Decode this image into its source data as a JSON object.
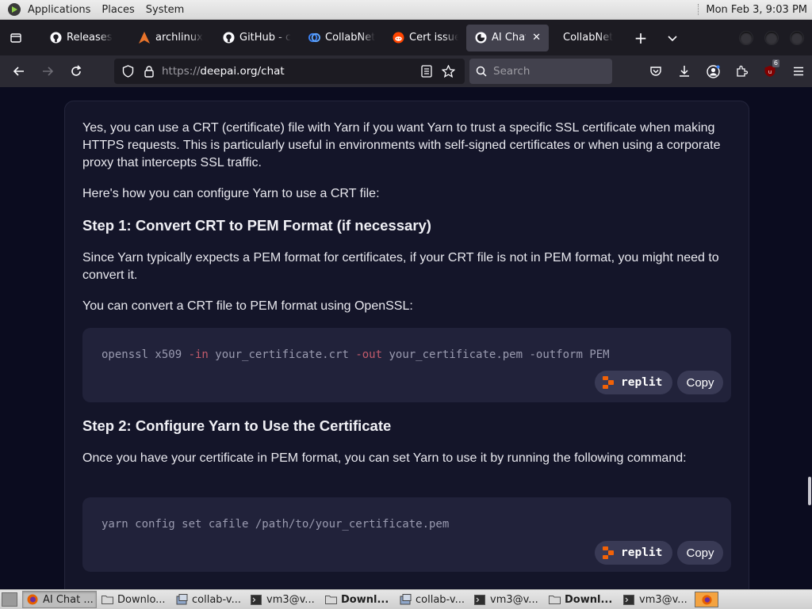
{
  "panel": {
    "menus": [
      "Applications",
      "Places",
      "System"
    ],
    "clock": "Mon Feb  3,  9:03 PM"
  },
  "tabs": [
    {
      "label": "Releases",
      "icon": "github-icon"
    },
    {
      "label": "archlinux",
      "icon": "archlinux-icon"
    },
    {
      "label": "GitHub - c",
      "icon": "github-icon"
    },
    {
      "label": "CollabNet",
      "icon": "collabnet-icon"
    },
    {
      "label": "Cert issue",
      "icon": "reddit-icon"
    },
    {
      "label": "AI Chat",
      "icon": "deepai-icon",
      "active": true
    },
    {
      "label": "CollabNet",
      "icon": "none"
    }
  ],
  "nav": {
    "url_prefix": "https://",
    "url_host": "deepai.org/chat",
    "search_placeholder": "Search",
    "extension_badge": "6"
  },
  "content": {
    "p1": "Yes, you can use a CRT (certificate) file with Yarn if you want Yarn to trust a specific SSL certificate when making HTTPS requests. This is particularly useful in environments with self-signed certificates or when using a corporate proxy that intercepts SSL traffic.",
    "p2": "Here's how you can configure Yarn to use a CRT file:",
    "h1": "Step 1: Convert CRT to PEM Format (if necessary)",
    "p3": "Since Yarn typically expects a PEM format for certificates, if your CRT file is not in PEM format, you might need to convert it.",
    "p4": "You can convert a CRT file to PEM format using OpenSSL:",
    "code1": {
      "a": "openssl x509 ",
      "b": "-in",
      "c": " your_certificate.crt ",
      "d": "-out",
      "e": " your_certificate.pem -outform PEM"
    },
    "h2": "Step 2: Configure Yarn to Use the Certificate",
    "p5": "Once you have your certificate in PEM format, you can set Yarn to use it by running the following command:",
    "code2": "yarn config set cafile /path/to/your_certificate.pem",
    "replit_label": "replit",
    "copy_label": "Copy"
  },
  "taskbar": [
    {
      "label": "AI Chat ...",
      "icon": "firefox-icon",
      "active": true,
      "bold": false
    },
    {
      "label": "Downlo...",
      "icon": "folder-icon",
      "bold": false
    },
    {
      "label": "collab-v...",
      "icon": "app-icon",
      "bold": false
    },
    {
      "label": "vm3@v...",
      "icon": "terminal-icon",
      "bold": false
    },
    {
      "label": "Downl...",
      "icon": "folder-icon",
      "bold": true
    },
    {
      "label": "collab-v...",
      "icon": "app-icon",
      "bold": false
    },
    {
      "label": "vm3@v...",
      "icon": "terminal-icon",
      "bold": false
    },
    {
      "label": "Downl...",
      "icon": "folder-icon",
      "bold": true
    },
    {
      "label": "vm3@v...",
      "icon": "terminal-icon",
      "bold": false
    }
  ],
  "colors": {
    "page_bg": "#0b0c1f",
    "card_bg": "#141529",
    "code_bg": "#21223a",
    "button_bg": "#393a55",
    "accent_orange": "#f26207"
  }
}
